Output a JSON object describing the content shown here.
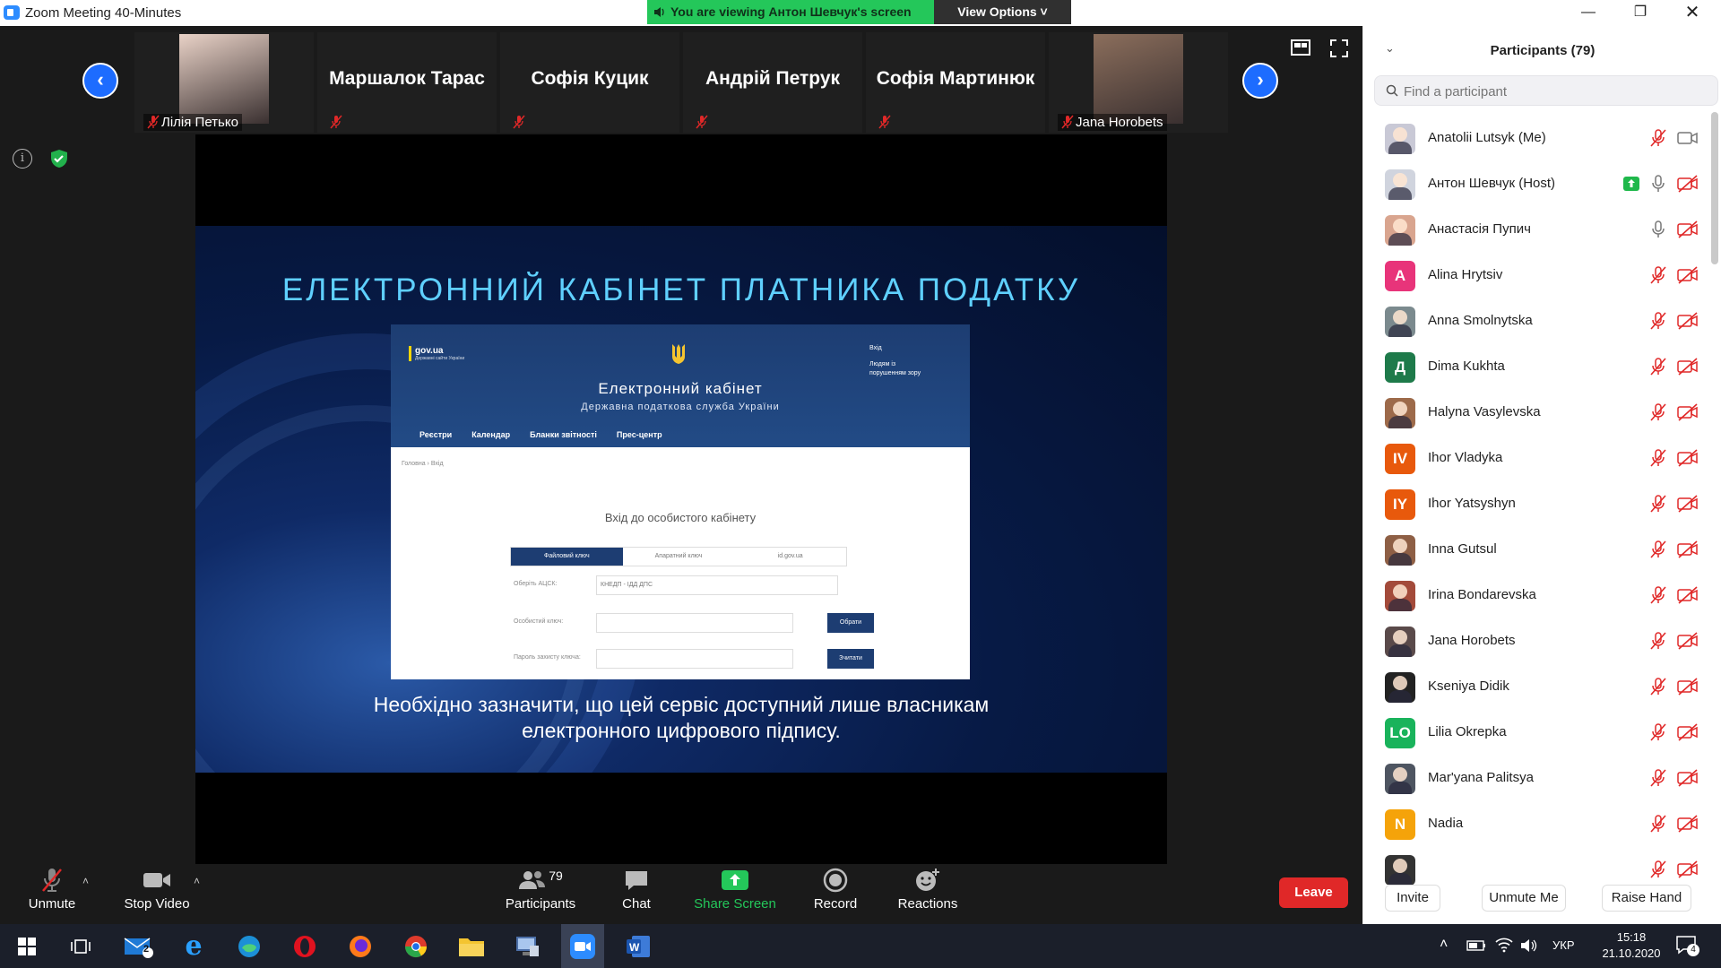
{
  "window": {
    "title": "Zoom Meeting 40-Minutes"
  },
  "banner": {
    "viewing": "You are viewing Антон Шевчук's screen",
    "options": "View Options"
  },
  "gallery": [
    {
      "name": "Лілія Петько",
      "photo": true,
      "tone": "#e9d2c7"
    },
    {
      "name": "Маршалок Тарас",
      "photo": false
    },
    {
      "name": "Софія Куцик",
      "photo": false
    },
    {
      "name": "Андрій Петрук",
      "photo": false
    },
    {
      "name": "Софія Мартинюк",
      "photo": false
    },
    {
      "name": "Jana Horobets",
      "photo": true,
      "tone": "#8b6e5c"
    }
  ],
  "slide": {
    "heading": "ЕЛЕКТРОННИЙ КАБІНЕТ ПЛАТНИКА ПОДАТКУ",
    "caption_line1": "Необхідно зазначити, що цей сервіс доступний лише власникам",
    "caption_line2": "електронного цифрового підпису.",
    "site": {
      "gov": "gov.ua",
      "gov_sub": "Державні сайти України",
      "login_link": "Вхід",
      "vision_link_1": "Людям із",
      "vision_link_2": "порушенням зору",
      "title": "Електронний кабінет",
      "subtitle": "Державна податкова служба України",
      "menu": [
        "Реєстри",
        "Календар",
        "Бланки звітності",
        "Прес-центр"
      ],
      "crumb_home": "Головна",
      "crumb_current": "Вхід",
      "login_title": "Вхід до особистого кабінету",
      "tabs": [
        "Файловий ключ",
        "Апаратний ключ",
        "id.gov.ua"
      ],
      "field1_label": "Оберіть АЦСК:",
      "field1_value": "КНЕДП - ІДД ДПС",
      "field2_label": "Особистий ключ:",
      "field2_button": "Обрати",
      "field3_label": "Пароль захисту ключа:",
      "field3_button": "Зчитати"
    }
  },
  "toolbar": {
    "unmute": "Unmute",
    "stop_video": "Stop Video",
    "participants": "Participants",
    "participants_count": "79",
    "chat": "Chat",
    "share_screen": "Share Screen",
    "record": "Record",
    "reactions": "Reactions",
    "leave": "Leave"
  },
  "panel": {
    "title": "Participants (79)",
    "search_placeholder": "Find a participant",
    "participants": [
      {
        "name": "Anatolii Lutsyk (Me)",
        "avatar": "photo",
        "color": "#c9c9d6",
        "mic": "muted",
        "video": "on"
      },
      {
        "name": "Антон Шевчук (Host)",
        "avatar": "photo",
        "color": "#d0d4de",
        "mic": "on",
        "video": "off",
        "sharing": true
      },
      {
        "name": "Анастасія Пупич",
        "avatar": "photo",
        "color": "#d9a58f",
        "mic": "on",
        "video": "off"
      },
      {
        "name": "Alina Hrytsiv",
        "avatar": "A",
        "color": "#e8347a",
        "mic": "muted",
        "video": "off"
      },
      {
        "name": "Anna Smolnytska",
        "avatar": "photo",
        "color": "#7b8a8e",
        "mic": "muted",
        "video": "off"
      },
      {
        "name": "Dima Kukhta",
        "avatar": "Д",
        "color": "#1e7a4a",
        "mic": "muted",
        "video": "off"
      },
      {
        "name": "Halyna Vasylevska",
        "avatar": "photo",
        "color": "#9d6a4a",
        "mic": "muted",
        "video": "off"
      },
      {
        "name": "Ihor Vladyka",
        "avatar": "IV",
        "color": "#e8590c",
        "mic": "muted",
        "video": "off"
      },
      {
        "name": "Ihor Yatsyshyn",
        "avatar": "IY",
        "color": "#e8590c",
        "mic": "muted",
        "video": "off"
      },
      {
        "name": "Inna Gutsul",
        "avatar": "photo",
        "color": "#8e5f45",
        "mic": "muted",
        "video": "off"
      },
      {
        "name": "Irina Bondarevska",
        "avatar": "photo",
        "color": "#a34a3a",
        "mic": "muted",
        "video": "off"
      },
      {
        "name": "Jana Horobets",
        "avatar": "photo",
        "color": "#5a4a4a",
        "mic": "muted",
        "video": "off"
      },
      {
        "name": "Kseniya Didik",
        "avatar": "photo",
        "color": "#222222",
        "mic": "muted",
        "video": "off"
      },
      {
        "name": "Lilia Okrepka",
        "avatar": "LO",
        "color": "#19b35b",
        "mic": "muted",
        "video": "off"
      },
      {
        "name": "Mar'yana Palitsya",
        "avatar": "photo",
        "color": "#4e5561",
        "mic": "muted",
        "video": "off"
      },
      {
        "name": "Nadia",
        "avatar": "N",
        "color": "#f5a30a",
        "mic": "muted",
        "video": "off"
      },
      {
        "name": "",
        "avatar": "photo",
        "color": "#333333",
        "mic": "muted",
        "video": "off"
      }
    ],
    "invite": "Invite",
    "unmute_me": "Unmute Me",
    "raise_hand": "Raise Hand"
  },
  "taskbar": {
    "mail_badge": "2",
    "language": "УКР",
    "time": "15:18",
    "date": "21.10.2020",
    "notifications": "4"
  },
  "colors": {
    "zoom_blue": "#2d8cff",
    "share_green": "#24c75a",
    "leave_red": "#e02828",
    "mute_red": "#e02828"
  }
}
